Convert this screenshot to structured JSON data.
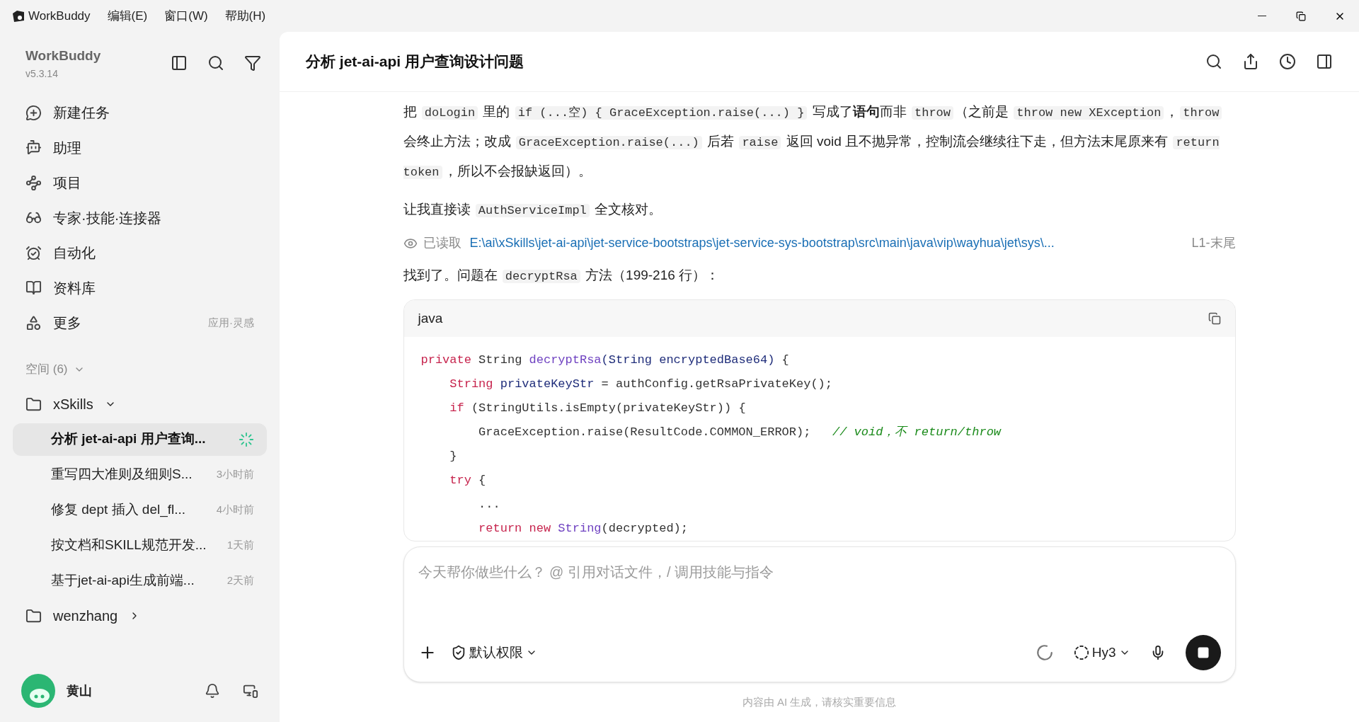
{
  "menu_bar": {
    "app_name": "WorkBuddy",
    "menus": [
      "编辑(E)",
      "窗口(W)",
      "帮助(H)"
    ]
  },
  "sidebar": {
    "app_name": "WorkBuddy",
    "version": "v5.3.14",
    "nav": [
      {
        "kind": "new-task",
        "label": "新建任务"
      },
      {
        "kind": "assistant",
        "label": "助理"
      },
      {
        "kind": "project",
        "label": "项目"
      },
      {
        "kind": "experts",
        "label": "专家·技能·连接器"
      },
      {
        "kind": "automation",
        "label": "自动化"
      },
      {
        "kind": "library",
        "label": "资料库"
      },
      {
        "kind": "more",
        "label": "更多",
        "hint": "应用·灵感"
      }
    ],
    "spaces": {
      "label": "空间 (6)",
      "expanded": true
    },
    "folders": [
      {
        "name": "xSkills",
        "expanded": true,
        "tasks": [
          {
            "title": "分析 jet-ai-api 用户查询...",
            "selected": true,
            "running": true
          },
          {
            "title": "重写四大准则及细则S...",
            "time": "3小时前",
            "selected": false,
            "running": false
          },
          {
            "title": "修复 dept 插入 del_fl...",
            "time": "4小时前",
            "selected": false,
            "running": false
          },
          {
            "title": "按文档和SKILL规范开发...",
            "time": "1天前",
            "selected": false,
            "running": false
          },
          {
            "title": "基于jet-ai-api生成前端...",
            "time": "2天前",
            "selected": false,
            "running": false
          }
        ]
      },
      {
        "name": "wenzhang",
        "expanded": false
      }
    ],
    "user": {
      "name": "黄山"
    }
  },
  "conversation": {
    "title": "分析 jet-ai-api 用户查询设计问题",
    "blocks": [
      {
        "kind": "paragraph",
        "segments": [
          {
            "kind": "text",
            "text": "把 "
          },
          {
            "kind": "code",
            "text": "doLogin"
          },
          {
            "kind": "text",
            "text": " 里的 "
          },
          {
            "kind": "code",
            "text": "if (...空) { GraceException.raise(...) }"
          },
          {
            "kind": "text",
            "text": " 写成了**语句**而非 "
          },
          {
            "kind": "code",
            "text": "throw"
          },
          {
            "kind": "text",
            "text": "（之前是 "
          },
          {
            "kind": "code",
            "text": "throw new XException"
          },
          {
            "kind": "text",
            "text": "，"
          },
          {
            "kind": "code",
            "text": "throw"
          },
          {
            "kind": "text",
            "text": " 会终止方法；改成 "
          },
          {
            "kind": "code",
            "text": "GraceException.raise(...)"
          },
          {
            "kind": "text",
            "text": " 后若 "
          },
          {
            "kind": "code",
            "text": "raise"
          },
          {
            "kind": "text",
            "text": " 返回 void 且不抛异常，控制流会继续往下走，但方法末尾原来有 "
          },
          {
            "kind": "code",
            "text": "return token"
          },
          {
            "kind": "text",
            "text": "，所以不会报缺返回）。"
          }
        ]
      },
      {
        "kind": "paragraph",
        "segments": [
          {
            "kind": "text",
            "text": "让我直接读 "
          },
          {
            "kind": "code",
            "text": "AuthServiceImpl"
          },
          {
            "kind": "text",
            "text": " 全文核对。"
          }
        ]
      },
      {
        "kind": "file-read",
        "label": "已读取",
        "path": "E:\\ai\\xSkills\\jet-ai-api\\jet-service-bootstraps\\jet-service-sys-bootstrap\\src\\main\\java\\vip\\wayhua\\jet\\sys\\...",
        "range": "L1-末尾"
      },
      {
        "kind": "paragraph",
        "segments": [
          {
            "kind": "text",
            "text": "找到了。问题在 "
          },
          {
            "kind": "code",
            "text": "decryptRsa"
          },
          {
            "kind": "text",
            "text": " 方法（199-216 行）："
          }
        ]
      },
      {
        "kind": "code",
        "language": "java",
        "lines": [
          [
            {
              "kind": "keyword",
              "text": "private"
            },
            {
              "kind": "plain",
              "text": " String "
            },
            {
              "kind": "function",
              "text": "decryptRsa"
            },
            {
              "kind": "param",
              "text": "(String encryptedBase64)"
            },
            {
              "kind": "plain",
              "text": " {"
            }
          ],
          [
            {
              "kind": "keyword",
              "text": "    String"
            },
            {
              "kind": "param",
              "text": " privateKeyStr"
            },
            {
              "kind": "plain",
              "text": " = authConfig.getRsaPrivateKey();"
            }
          ],
          [
            {
              "kind": "keyword",
              "text": "    if"
            },
            {
              "kind": "plain",
              "text": " (StringUtils.isEmpty(privateKeyStr)) {"
            }
          ],
          [
            {
              "kind": "plain",
              "text": "        GraceException.raise(ResultCode.COMMON_ERROR);   "
            },
            {
              "kind": "comment",
              "text": "// void，不 return/throw"
            }
          ],
          [
            {
              "kind": "plain",
              "text": "    }"
            }
          ],
          [
            {
              "kind": "keyword",
              "text": "    try"
            },
            {
              "kind": "plain",
              "text": " {"
            }
          ],
          [
            {
              "kind": "plain",
              "text": "        ..."
            }
          ],
          [
            {
              "kind": "keyword",
              "text": "        return new"
            },
            {
              "kind": "function",
              "text": " String"
            },
            {
              "kind": "plain",
              "text": "(decrypted);"
            }
          ]
        ]
      }
    ]
  },
  "composer": {
    "placeholder": "今天帮你做些什么？ @ 引用对话文件，/ 调用技能与指令",
    "permission": "默认权限",
    "model": "Hy3",
    "busy": true
  },
  "disclaimer": "内容由 AI 生成，请核实重要信息"
}
